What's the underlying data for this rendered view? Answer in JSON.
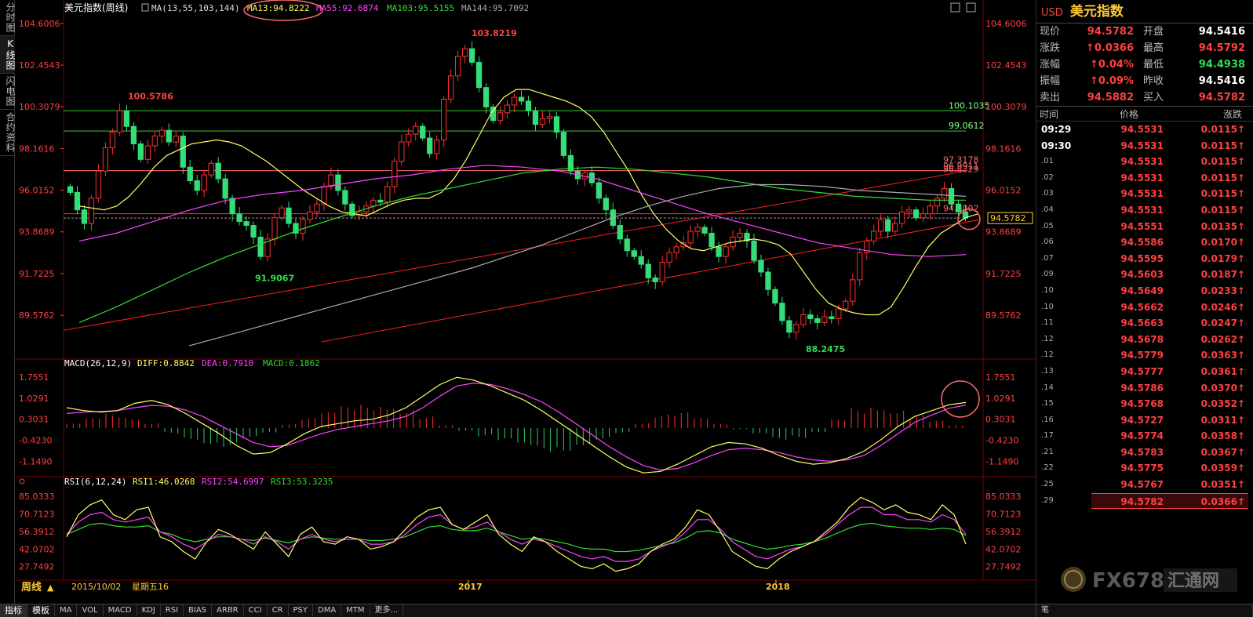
{
  "left_tabs": [
    "分时图",
    "K线图",
    "闪电图",
    "合约资料"
  ],
  "header": {
    "title": "美元指数(周线)",
    "ma_label": "MA(13,55,103,144)",
    "ma13": "MA13:94.8222",
    "ma55": "MA55:92.6874",
    "ma103": "MA103:95.5155",
    "ma144": "MA144:95.7092"
  },
  "macd_header": {
    "label": "MACD(26,12,9)",
    "diff": "DIFF:0.8842",
    "dea": "DEA:0.7910",
    "macd": "MACD:0.1862"
  },
  "rsi_header": {
    "label": "RSI(6,12,24)",
    "rsi1": "RSI1:46.0268",
    "rsi2": "RSI2:54.6997",
    "rsi3": "RSI3:53.3235"
  },
  "footer": {
    "period": "周线",
    "date": "2015/10/02",
    "weekday": "星期五16"
  },
  "bottom_tabs": [
    "指标",
    "模板",
    "MA",
    "VOL",
    "MACD",
    "KDJ",
    "RSI",
    "BIAS",
    "ARBR",
    "CCI",
    "CR",
    "PSY",
    "DMA",
    "MTM",
    "更多..."
  ],
  "bottom_right": "笔",
  "side": {
    "code": "USD",
    "name": "美元指数",
    "quote": [
      {
        "l1": "现价",
        "v1": "94.5782",
        "c1": "red",
        "l2": "开盘",
        "v2": "94.5416",
        "c2": "wht"
      },
      {
        "l1": "涨跌",
        "v1": "↑0.0366",
        "c1": "red",
        "l2": "最高",
        "v2": "94.5792",
        "c2": "red"
      },
      {
        "l1": "涨幅",
        "v1": "↑0.04%",
        "c1": "red",
        "l2": "最低",
        "v2": "94.4938",
        "c2": "grn"
      },
      {
        "l1": "振幅",
        "v1": "↑0.09%",
        "c1": "red",
        "l2": "昨收",
        "v2": "94.5416",
        "c2": "wht"
      },
      {
        "l1": "卖出",
        "v1": "94.5882",
        "c1": "red",
        "l2": "买入",
        "v2": "94.5782",
        "c2": "red"
      }
    ],
    "tick_head": {
      "time": "时间",
      "price": "价格",
      "change": "涨跌"
    },
    "ticks": [
      {
        "t": "09:29",
        "p": "94.5531",
        "c": "0.0115↑"
      },
      {
        "t": "09:30",
        "p": "94.5531",
        "c": "0.0115↑"
      },
      {
        "t": ".01",
        "p": "94.5531",
        "c": "0.0115↑"
      },
      {
        "t": ".02",
        "p": "94.5531",
        "c": "0.0115↑"
      },
      {
        "t": ".03",
        "p": "94.5531",
        "c": "0.0115↑"
      },
      {
        "t": ".04",
        "p": "94.5531",
        "c": "0.0115↑"
      },
      {
        "t": ".05",
        "p": "94.5551",
        "c": "0.0135↑"
      },
      {
        "t": ".06",
        "p": "94.5586",
        "c": "0.0170↑"
      },
      {
        "t": ".07",
        "p": "94.5595",
        "c": "0.0179↑"
      },
      {
        "t": ".09",
        "p": "94.5603",
        "c": "0.0187↑"
      },
      {
        "t": ".10",
        "p": "94.5649",
        "c": "0.0233↑"
      },
      {
        "t": ".10",
        "p": "94.5662",
        "c": "0.0246↑"
      },
      {
        "t": ".11",
        "p": "94.5663",
        "c": "0.0247↑"
      },
      {
        "t": ".12",
        "p": "94.5678",
        "c": "0.0262↑"
      },
      {
        "t": ".12",
        "p": "94.5779",
        "c": "0.0363↑"
      },
      {
        "t": ".13",
        "p": "94.5777",
        "c": "0.0361↑"
      },
      {
        "t": ".14",
        "p": "94.5786",
        "c": "0.0370↑"
      },
      {
        "t": ".15",
        "p": "94.5768",
        "c": "0.0352↑"
      },
      {
        "t": ".16",
        "p": "94.5727",
        "c": "0.0311↑"
      },
      {
        "t": ".17",
        "p": "94.5774",
        "c": "0.0358↑"
      },
      {
        "t": ".21",
        "p": "94.5783",
        "c": "0.0367↑"
      },
      {
        "t": ".22",
        "p": "94.5775",
        "c": "0.0359↑"
      },
      {
        "t": ".25",
        "p": "94.5767",
        "c": "0.0351↑"
      },
      {
        "t": ".29",
        "p": "94.5782",
        "c": "0.0366↑"
      }
    ]
  },
  "logo": {
    "text": "FX678",
    "cn": "汇通网"
  },
  "chart_data": [
    {
      "type": "candlestick",
      "title": "美元指数(周线)",
      "y_ticks": [
        "104.6006",
        "102.4543",
        "100.3079",
        "98.1616",
        "96.0152",
        "93.8689",
        "91.7225",
        "89.5762"
      ],
      "ylim": [
        87.4,
        105.0
      ],
      "x_labels": [
        "2017",
        "2018"
      ],
      "current_price_label": "94.5782",
      "current_price": 94.5782,
      "annotations": [
        {
          "text": "103.8219",
          "value": 103.8219
        },
        {
          "text": "100.5786",
          "value": 100.5786
        },
        {
          "text": "91.9067",
          "value": 91.9067
        },
        {
          "text": "88.2475",
          "value": 88.2475
        }
      ],
      "levels": [
        {
          "text": "100.1035",
          "value": 100.1035,
          "color": "#33cc33"
        },
        {
          "text": "99.0612",
          "value": 99.0612,
          "color": "#33cc33"
        },
        {
          "text": "97.3178",
          "value": 97.3178,
          "color": "#ff6b6b"
        },
        {
          "text": "96.9911",
          "value": 96.9911,
          "color": "#ff6b6b"
        },
        {
          "text": "96.8329",
          "value": 96.8329,
          "color": "#ff6b6b"
        },
        {
          "text": "94.8002",
          "value": 94.8002,
          "color": "#ff6b6b"
        }
      ],
      "ohlc_close_path": [
        95.9,
        95.0,
        94.3,
        95.6,
        97.0,
        98.2,
        99.0,
        100.1,
        99.3,
        98.4,
        97.6,
        98.3,
        98.8,
        99.1,
        98.5,
        98.8,
        97.2,
        96.5,
        96.0,
        96.8,
        97.4,
        96.6,
        95.6,
        94.8,
        94.4,
        94.2,
        93.6,
        92.6,
        93.5,
        94.6,
        95.1,
        94.3,
        93.8,
        94.5,
        94.9,
        95.3,
        96.2,
        96.8,
        96.0,
        95.3,
        94.7,
        94.9,
        95.2,
        95.5,
        95.4,
        96.2,
        97.5,
        98.5,
        98.9,
        99.3,
        98.7,
        97.9,
        98.6,
        100.7,
        101.9,
        102.9,
        103.3,
        102.6,
        101.3,
        100.3,
        99.6,
        100.0,
        100.4,
        100.8,
        100.6,
        100.1,
        99.4,
        99.7,
        99.8,
        99.0,
        97.8,
        97.0,
        96.6,
        96.9,
        96.4,
        95.6,
        95.0,
        94.2,
        93.5,
        92.9,
        92.6,
        92.2,
        91.5,
        91.3,
        92.3,
        92.8,
        93.1,
        93.3,
        93.9,
        94.1,
        93.8,
        93.1,
        92.6,
        93.1,
        93.6,
        93.8,
        93.4,
        92.4,
        91.8,
        90.9,
        90.2,
        89.3,
        88.7,
        89.1,
        89.6,
        89.4,
        89.2,
        89.5,
        89.4,
        89.9,
        90.3,
        91.4,
        92.8,
        93.4,
        93.9,
        94.5,
        93.9,
        94.3,
        94.9,
        95.0,
        94.6,
        94.8,
        95.2,
        95.6,
        96.1,
        95.3,
        94.9,
        94.58
      ],
      "ma13": [
        95.2,
        95.1,
        95.0,
        95.2,
        95.7,
        96.4,
        97.2,
        97.8,
        98.1,
        98.4,
        98.5,
        98.6,
        98.5,
        98.3,
        97.9,
        97.5,
        97.0,
        96.5,
        96.0,
        95.6,
        95.2,
        94.9,
        94.8,
        94.7,
        95.0,
        95.3,
        95.5,
        95.6,
        95.6,
        95.9,
        96.6,
        97.6,
        98.8,
        100.0,
        100.8,
        101.2,
        101.2,
        101.0,
        100.8,
        100.6,
        100.3,
        99.8,
        99.0,
        98.0,
        97.0,
        95.8,
        94.8,
        94.0,
        93.4,
        93.0,
        92.9,
        93.1,
        93.3,
        93.4,
        93.5,
        93.4,
        93.2,
        92.7,
        91.8,
        90.9,
        90.2,
        89.9,
        89.7,
        89.6,
        89.6,
        90.0,
        91.0,
        92.1,
        93.1,
        93.8,
        94.2,
        94.6,
        94.8
      ],
      "ma55": [
        93.4,
        93.8,
        94.4,
        95.0,
        95.5,
        95.8,
        96.0,
        96.3,
        96.6,
        96.8,
        97.1,
        97.3,
        97.2,
        97.0,
        96.6,
        96.0,
        95.4,
        94.8,
        94.3,
        93.8,
        93.3,
        93.0,
        92.7,
        92.6,
        92.7
      ],
      "ma103": [
        89.2,
        90.0,
        90.9,
        91.8,
        92.6,
        93.3,
        94.0,
        94.6,
        95.2,
        95.7,
        96.1,
        96.5,
        96.9,
        97.1,
        97.2,
        97.1,
        96.9,
        96.7,
        96.4,
        96.1,
        95.9,
        95.7,
        95.6,
        95.5,
        95.5
      ],
      "ma144": [
        88.0,
        88.5,
        89.0,
        89.5,
        90.0,
        90.5,
        91.0,
        91.5,
        92.0,
        92.6,
        93.2,
        93.9,
        94.6,
        95.2,
        95.7,
        96.1,
        96.3,
        96.3,
        96.2,
        96.0,
        95.9,
        95.8,
        95.7
      ],
      "trendlines": [
        {
          "from": 88.8,
          "to": 97.0
        },
        {
          "from": 88.2,
          "to": 94.5
        }
      ]
    },
    {
      "type": "bar+line",
      "title": "MACD(26,12,9)",
      "y_ticks": [
        "1.7551",
        "1.0291",
        "0.3031",
        "-0.4230",
        "-1.1490"
      ],
      "ylim": [
        -1.6,
        2.0
      ],
      "diff": [
        0.7,
        0.6,
        0.55,
        0.6,
        0.85,
        0.95,
        0.8,
        0.5,
        0.15,
        -0.2,
        -0.6,
        -0.9,
        -0.85,
        -0.55,
        -0.2,
        0.05,
        0.15,
        0.25,
        0.3,
        0.45,
        0.7,
        1.1,
        1.5,
        1.75,
        1.65,
        1.45,
        1.2,
        0.95,
        0.6,
        0.2,
        -0.2,
        -0.6,
        -1.0,
        -1.35,
        -1.55,
        -1.5,
        -1.25,
        -0.95,
        -0.65,
        -0.5,
        -0.55,
        -0.7,
        -0.95,
        -1.15,
        -1.25,
        -1.2,
        -1.05,
        -0.8,
        -0.4,
        0.05,
        0.4,
        0.6,
        0.8,
        0.88
      ],
      "dea": [
        0.5,
        0.55,
        0.57,
        0.6,
        0.7,
        0.78,
        0.75,
        0.62,
        0.4,
        0.1,
        -0.2,
        -0.5,
        -0.65,
        -0.6,
        -0.4,
        -0.2,
        -0.05,
        0.05,
        0.15,
        0.25,
        0.4,
        0.7,
        1.1,
        1.45,
        1.55,
        1.5,
        1.35,
        1.15,
        0.9,
        0.55,
        0.15,
        -0.25,
        -0.65,
        -1.0,
        -1.3,
        -1.45,
        -1.4,
        -1.2,
        -0.95,
        -0.75,
        -0.7,
        -0.75,
        -0.85,
        -1.0,
        -1.1,
        -1.15,
        -1.1,
        -0.95,
        -0.6,
        -0.2,
        0.2,
        0.45,
        0.68,
        0.79
      ],
      "hist": [
        0.15,
        0.35,
        0.5,
        0.4,
        0.2,
        -0.2,
        -0.4,
        -0.55,
        -0.65,
        -0.4,
        -0.2,
        0.15,
        0.35,
        0.55,
        0.75,
        0.85,
        0.9,
        0.7,
        0.4,
        0.1,
        -0.1,
        -0.3,
        -0.5,
        -0.7,
        -0.85,
        -0.8,
        -0.6,
        -0.4,
        -0.2,
        0.2,
        0.5,
        0.55,
        0.35,
        0.15,
        -0.05,
        -0.25,
        -0.45,
        -0.35,
        -0.15,
        0.3,
        0.7,
        0.85,
        0.7,
        0.45,
        0.25,
        0.1
      ]
    },
    {
      "type": "line",
      "title": "RSI(6,12,24)",
      "y_ticks": [
        "85.0333",
        "70.7123",
        "56.3912",
        "42.0702",
        "27.7492"
      ],
      "ylim": [
        18,
        92
      ],
      "rsi1": [
        52,
        70,
        78,
        82,
        70,
        66,
        74,
        76,
        52,
        48,
        40,
        34,
        48,
        58,
        54,
        48,
        42,
        56,
        46,
        36,
        54,
        60,
        48,
        46,
        52,
        50,
        42,
        44,
        48,
        58,
        68,
        74,
        76,
        62,
        58,
        64,
        70,
        54,
        46,
        40,
        52,
        48,
        40,
        34,
        28,
        26,
        30,
        24,
        26,
        30,
        40,
        46,
        50,
        60,
        74,
        70,
        56,
        40,
        34,
        28,
        26,
        34,
        40,
        44,
        48,
        56,
        64,
        76,
        84,
        80,
        74,
        78,
        72,
        70,
        66,
        78,
        70,
        46
      ],
      "rsi2": [
        54,
        64,
        70,
        72,
        66,
        64,
        66,
        68,
        56,
        52,
        46,
        42,
        48,
        54,
        52,
        50,
        46,
        52,
        48,
        42,
        50,
        54,
        50,
        48,
        50,
        50,
        46,
        46,
        48,
        54,
        62,
        68,
        70,
        62,
        58,
        60,
        64,
        56,
        50,
        46,
        50,
        48,
        44,
        40,
        36,
        34,
        36,
        32,
        32,
        34,
        40,
        44,
        48,
        56,
        66,
        66,
        58,
        48,
        42,
        36,
        34,
        38,
        42,
        44,
        48,
        54,
        62,
        70,
        76,
        76,
        70,
        70,
        66,
        66,
        64,
        70,
        66,
        54
      ],
      "rsi3": [
        54,
        58,
        62,
        63,
        61,
        60,
        60,
        61,
        56,
        54,
        50,
        48,
        50,
        52,
        52,
        50,
        49,
        51,
        49,
        47,
        50,
        52,
        51,
        50,
        50,
        50,
        49,
        49,
        50,
        52,
        56,
        60,
        61,
        58,
        57,
        57,
        59,
        56,
        53,
        50,
        51,
        50,
        48,
        46,
        43,
        42,
        42,
        40,
        40,
        41,
        43,
        45,
        47,
        51,
        56,
        57,
        55,
        50,
        47,
        44,
        42,
        43,
        45,
        46,
        48,
        51,
        55,
        59,
        62,
        63,
        61,
        60,
        59,
        59,
        58,
        59,
        58,
        53
      ]
    }
  ]
}
